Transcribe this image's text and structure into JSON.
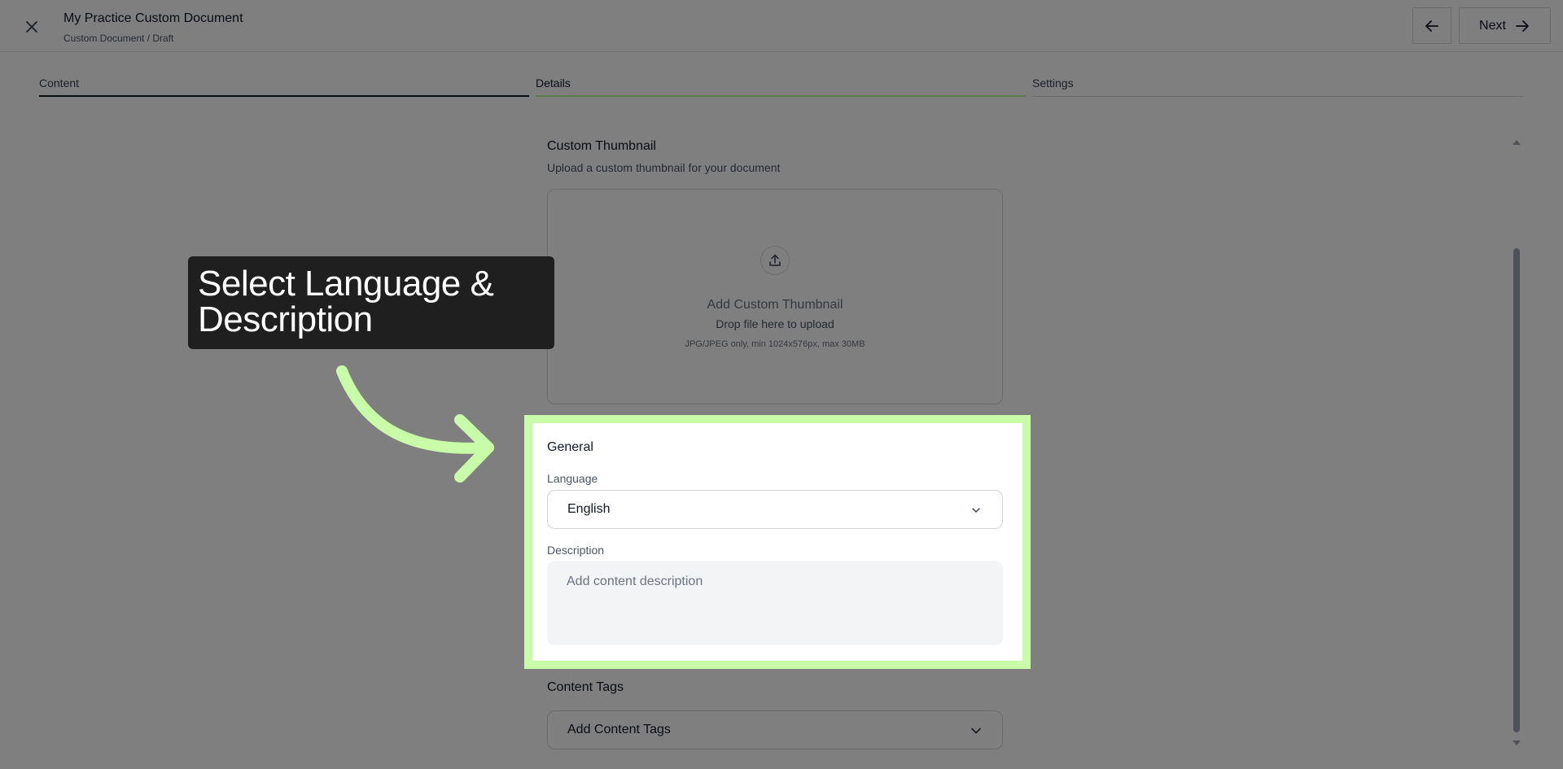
{
  "header": {
    "title": "My Practice Custom Document",
    "breadcrumb": "Custom Document / Draft",
    "next_label": "Next"
  },
  "steps": [
    {
      "label": "Content",
      "state": "completed"
    },
    {
      "label": "Details",
      "state": "active"
    },
    {
      "label": "Settings",
      "state": "upcoming"
    }
  ],
  "thumbnail": {
    "title": "Custom Thumbnail",
    "subtitle": "Upload a custom thumbnail for your document",
    "dropzone_title": "Add Custom Thumbnail",
    "dropzone_sub": "Drop file here to upload",
    "dropzone_note": "JPG/JPEG only, min 1024x576px, max 30MB"
  },
  "general": {
    "title": "General",
    "language_label": "Language",
    "language_value": "English",
    "description_label": "Description",
    "description_placeholder": "Add content description"
  },
  "tags": {
    "title": "Content Tags",
    "select_label": "Add Content Tags"
  },
  "callout": {
    "text": "Select Language & Description"
  },
  "colors": {
    "highlight": "#c8fca8",
    "callout_bg": "#1f1f1f",
    "active_step": "#b8f59a"
  },
  "icons": [
    "close-icon",
    "arrow-left-icon",
    "arrow-right-icon",
    "upload-icon",
    "chevron-down-icon",
    "callout-arrow"
  ]
}
